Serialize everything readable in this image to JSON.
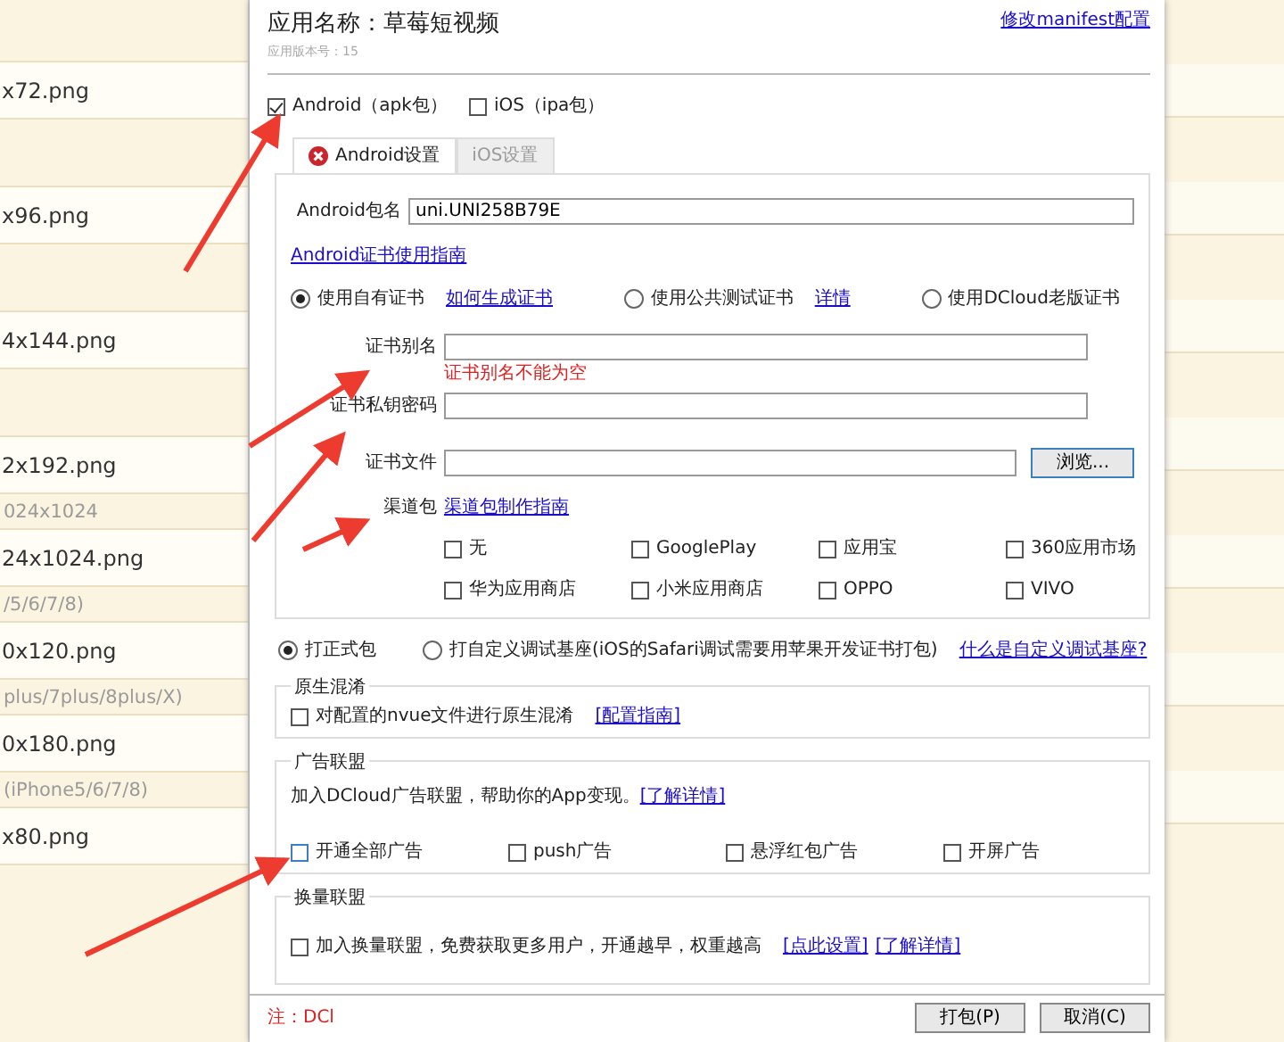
{
  "file_list": [
    {
      "kind": "file",
      "text": "x72.png"
    },
    {
      "kind": "file",
      "text": "x96.png"
    },
    {
      "kind": "file",
      "text": "4x144.png"
    },
    {
      "kind": "file",
      "text": "2x192.png"
    },
    {
      "kind": "caption",
      "text": "024x1024"
    },
    {
      "kind": "file",
      "text": "24x1024.png"
    },
    {
      "kind": "caption",
      "text": "/5/6/7/8)"
    },
    {
      "kind": "file",
      "text": "0x120.png"
    },
    {
      "kind": "caption",
      "text": "plus/7plus/8plus/X)"
    },
    {
      "kind": "file",
      "text": "0x180.png"
    },
    {
      "kind": "caption",
      "text": "(iPhone5/6/7/8)"
    },
    {
      "kind": "file",
      "text": "x80.png"
    }
  ],
  "dialog": {
    "app_name": "应用名称：草莓短视频",
    "app_version": "应用版本号：15",
    "manifest_link": "修改manifest配置",
    "platforms": [
      {
        "label": "Android（apk包）",
        "checked": true
      },
      {
        "label": "iOS（ipa包）",
        "checked": false
      }
    ],
    "tabs": [
      {
        "label": "Android设置",
        "selected": true,
        "error": true
      },
      {
        "label": "iOS设置",
        "selected": false,
        "error": false
      }
    ],
    "package_name": {
      "label": "Android包名",
      "value": "uni.UNI258B79E"
    },
    "cert_guide_link": "Android证书使用指南",
    "cert_options": [
      {
        "label": "使用自有证书",
        "selected": true,
        "link": "如何生成证书"
      },
      {
        "label": "使用公共测试证书",
        "selected": false,
        "link": "详情"
      },
      {
        "label": "使用DCloud老版证书",
        "selected": false
      }
    ],
    "cert_fields": [
      {
        "label": "证书别名",
        "error": "证书别名不能为空"
      },
      {
        "label": "证书私钥密码"
      },
      {
        "label": "证书文件",
        "button": "浏览..."
      }
    ],
    "channel": {
      "label": "渠道包",
      "link": "渠道包制作指南",
      "options": [
        {
          "label": "无",
          "checked": false
        },
        {
          "label": "GooglePlay",
          "checked": false
        },
        {
          "label": "应用宝",
          "checked": false
        },
        {
          "label": "360应用市场",
          "checked": false
        },
        {
          "label": "华为应用商店",
          "checked": false
        },
        {
          "label": "小米应用商店",
          "checked": false
        },
        {
          "label": "OPPO",
          "checked": false
        },
        {
          "label": "VIVO",
          "checked": false
        }
      ]
    },
    "build_types": [
      {
        "label": "打正式包",
        "selected": true
      },
      {
        "label": "打自定义调试基座(iOS的Safari调试需要用苹果开发证书打包)",
        "selected": false,
        "link": "什么是自定义调试基座?"
      }
    ],
    "obfuscation": {
      "legend": "原生混淆",
      "label": "对配置的nvue文件进行原生混淆",
      "checked": false,
      "link": "[配置指南]"
    },
    "ads": {
      "legend": "广告联盟",
      "intro": "加入DCloud广告联盟，帮助你的App变现。",
      "link": "[了解详情]",
      "options": [
        {
          "label": "开通全部广告",
          "checked": false
        },
        {
          "label": "push广告",
          "checked": false
        },
        {
          "label": "悬浮红包广告",
          "checked": false
        },
        {
          "label": "开屏广告",
          "checked": false
        }
      ]
    },
    "exchange": {
      "legend": "换量联盟",
      "label": "加入换量联盟，免费获取更多用户，开通越早，权重越高",
      "checked": false,
      "links": [
        "[点此设置]",
        "[了解详情]"
      ]
    },
    "note": "注：DCl",
    "buttons": [
      "打包(P)",
      "取消(C)"
    ]
  }
}
